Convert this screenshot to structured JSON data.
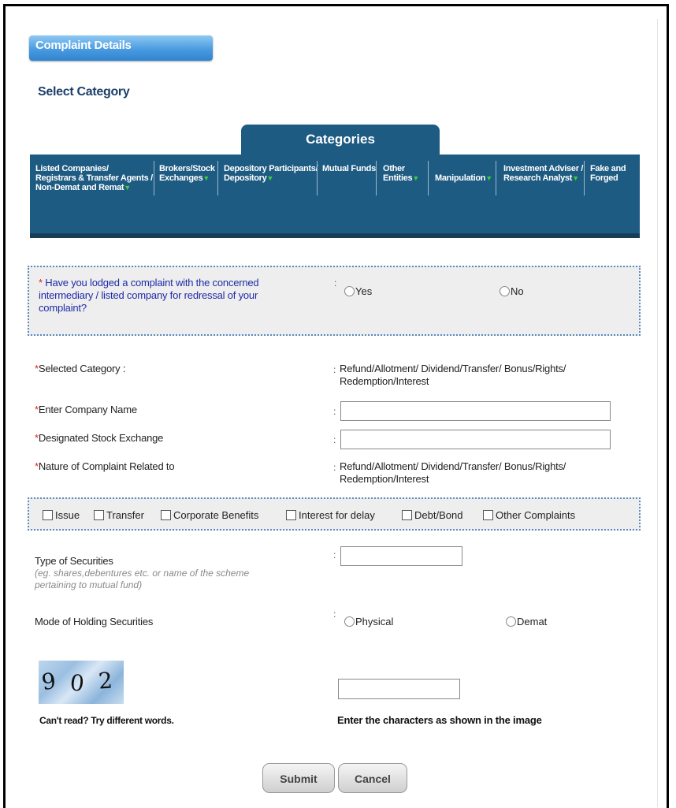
{
  "header": {
    "title": "Complaint Details",
    "subtitle": "Select Category"
  },
  "categories": {
    "tab_label": "Categories",
    "items": [
      {
        "line1": "Listed Companies/",
        "line2": "Registrars & Transfer Agents /",
        "line3": "Non-Demat and Remat",
        "arrow": "▼"
      },
      {
        "line1": "Brokers/Stock",
        "line2": "Exchanges",
        "arrow": "▼"
      },
      {
        "line1": "Depository Participants/",
        "line2": "Depository",
        "arrow": "▼"
      },
      {
        "line1": "Mutual Funds"
      },
      {
        "line1": "Other",
        "line2": "Entities",
        "arrow": "▼"
      },
      {
        "line1": "Manipulation",
        "arrow": "▼"
      },
      {
        "line1": "Investment Adviser /",
        "line2": "Research Analyst",
        "arrow": "▼"
      },
      {
        "line1": "Fake and",
        "line2": "Forged"
      }
    ]
  },
  "lodged_question": {
    "required_mark": "*",
    "text": " Have you lodged a complaint with the concerned intermediary / listed company for redressal of your complaint?",
    "colon": ":",
    "options": [
      "Yes",
      "No"
    ]
  },
  "form": {
    "selected_category_label": "Selected Category :",
    "selected_category_value": "Refund/Allotment/ Dividend/Transfer/ Bonus/Rights/ Redemption/Interest",
    "company_name_label": "Enter Company Name",
    "company_name_value": "",
    "stock_exchange_label": "Designated Stock Exchange",
    "stock_exchange_value": "",
    "nature_label": "Nature of Complaint Related to",
    "nature_value": "Refund/Allotment/ Dividend/Transfer/ Bonus/Rights/ Redemption/Interest",
    "required_mark": "*",
    "colon": ":"
  },
  "complaint_types": [
    "Issue",
    "Transfer",
    "Corporate Benefits",
    "Interest for delay",
    "Debt/Bond",
    "Other Complaints"
  ],
  "securities": {
    "type_label": "Type of Securities",
    "type_hint": "(eg. shares,debentures etc. or name of the scheme pertaining to mutual fund)",
    "type_value": "",
    "mode_label": "Mode of Holding Securities",
    "mode_options": [
      "Physical",
      "Demat"
    ]
  },
  "captcha": {
    "characters": [
      "9",
      "0",
      "2"
    ],
    "refresh_text": "Can't read? Try different words.",
    "instruction": "Enter the characters as shown in the image",
    "input_value": ""
  },
  "buttons": {
    "submit": "Submit",
    "cancel": "Cancel"
  }
}
